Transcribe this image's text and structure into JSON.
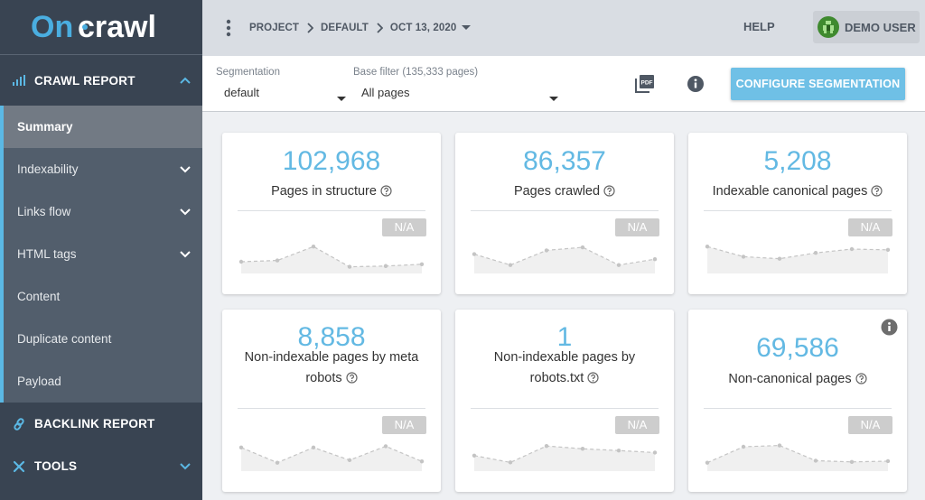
{
  "app": {
    "brand_left": "On",
    "brand_right": "crawl"
  },
  "sidebar": {
    "crawl_report": {
      "label": "CRAWL REPORT",
      "icon": "bar-signal-icon",
      "expanded": true,
      "items": [
        {
          "label": "Summary",
          "active": true,
          "has_children": false
        },
        {
          "label": "Indexability",
          "active": false,
          "has_children": true
        },
        {
          "label": "Links flow",
          "active": false,
          "has_children": true
        },
        {
          "label": "HTML tags",
          "active": false,
          "has_children": true
        },
        {
          "label": "Content",
          "active": false,
          "has_children": false
        },
        {
          "label": "Duplicate content",
          "active": false,
          "has_children": false
        },
        {
          "label": "Payload",
          "active": false,
          "has_children": false
        }
      ]
    },
    "backlink_report": {
      "label": "BACKLINK REPORT",
      "icon": "link-icon"
    },
    "tools": {
      "label": "TOOLS",
      "icon": "tools-icon"
    }
  },
  "topbar": {
    "breadcrumb": [
      "PROJECT",
      "DEFAULT",
      "OCT 13, 2020"
    ],
    "help_label": "HELP",
    "user_name": "DEMO USER"
  },
  "filters": {
    "segmentation_label": "Segmentation",
    "segmentation_value": "default",
    "base_filter_label": "Base filter (135,333 pages)",
    "base_filter_value": "All pages",
    "pdf_icon_label": "PDF",
    "configure_button": "CONFIGURE SEGMENTATION"
  },
  "colors": {
    "accent": "#63b9e3",
    "sidebar_bg": "#394452",
    "submenu_bg": "#525e6c",
    "button_bg": "#6fc0e6"
  },
  "cards": [
    {
      "value": "102,968",
      "label": "Pages in structure",
      "badge": "N/A",
      "trend": [
        0.25,
        0.3,
        0.85,
        0.05,
        0.08,
        0.15
      ]
    },
    {
      "value": "86,357",
      "label": "Pages crawled",
      "badge": "N/A",
      "trend": [
        0.55,
        0.12,
        0.7,
        0.82,
        0.12,
        0.35
      ]
    },
    {
      "value": "5,208",
      "label": "Indexable canonical pages",
      "badge": "N/A",
      "trend": [
        0.85,
        0.45,
        0.37,
        0.6,
        0.75,
        0.72
      ]
    },
    {
      "value": "8,858",
      "label": "Non-indexable pages by meta robots",
      "badge": "N/A",
      "trend": [
        0.72,
        0.12,
        0.72,
        0.22,
        0.77,
        0.17
      ]
    },
    {
      "value": "1",
      "label": "Non-indexable pages by robots.txt",
      "badge": "N/A",
      "trend": [
        0.4,
        0.13,
        0.78,
        0.67,
        0.6,
        0.52
      ]
    },
    {
      "value": "69,586",
      "label": "Non-canonical pages",
      "badge": "N/A",
      "trend": [
        0.12,
        0.75,
        0.8,
        0.2,
        0.15,
        0.18
      ],
      "has_info": true
    }
  ]
}
